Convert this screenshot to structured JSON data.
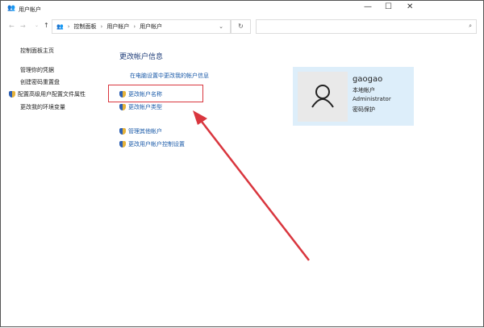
{
  "window": {
    "title": "用户帐户",
    "controls": [
      "—",
      "☐",
      "✕"
    ]
  },
  "address": {
    "crumbs": [
      "控制面板",
      "用户帐户",
      "用户帐户"
    ],
    "search_placeholder": ""
  },
  "sidebar": {
    "home": "控制面板主页",
    "items": [
      "管理你的凭据",
      "创建密码重置盘",
      "配置高级用户配置文件属性",
      "更改我的环境变量"
    ]
  },
  "main": {
    "heading": "更改帐户信息",
    "pc_settings_link": "在电脑设置中更改我的帐户信息",
    "links": [
      "更改帐户名称",
      "更改帐户类型",
      "管理其他帐户",
      "更改用户帐户控制设置"
    ]
  },
  "account": {
    "name": "gaogao",
    "type": "本地帐户",
    "role": "Administrator",
    "password": "密码保护"
  },
  "colors": {
    "highlight": "#d9363e",
    "link": "#1a5aa8",
    "card": "#ddeefa"
  }
}
